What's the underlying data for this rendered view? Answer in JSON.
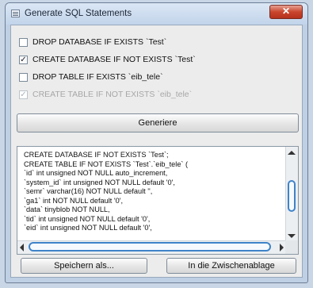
{
  "window": {
    "title": "Generate SQL Statements",
    "close_glyph": "✕"
  },
  "options": [
    {
      "label": "DROP DATABASE IF EXISTS `Test`",
      "checked": false,
      "enabled": true
    },
    {
      "label": "CREATE DATABASE IF NOT EXISTS `Test`",
      "checked": true,
      "enabled": true
    },
    {
      "label": "DROP TABLE IF EXISTS `eib_tele`",
      "checked": false,
      "enabled": true
    },
    {
      "label": "CREATE TABLE IF NOT EXISTS `eib_tele`",
      "checked": true,
      "enabled": false
    }
  ],
  "generate_button": "Generiere",
  "sql_output": {
    "lines": [
      "CREATE DATABASE IF NOT EXISTS `Test`;",
      "CREATE TABLE IF NOT EXISTS `Test`.`eib_tele` (",
      "`id` int unsigned NOT NULL auto_increment,",
      "`system_id` int unsigned NOT NULL default '0',",
      "`semr` varchar(16) NOT NULL default '',",
      "`ga1` int NOT NULL default '0',",
      "`data` tinyblob NOT NULL,",
      "`tid` int unsigned NOT NULL default '0',",
      "`eid` int unsigned NOT NULL default '0',"
    ]
  },
  "footer": {
    "save_button": "Speichern als...",
    "clipboard_button": "In die Zwischenablage"
  }
}
